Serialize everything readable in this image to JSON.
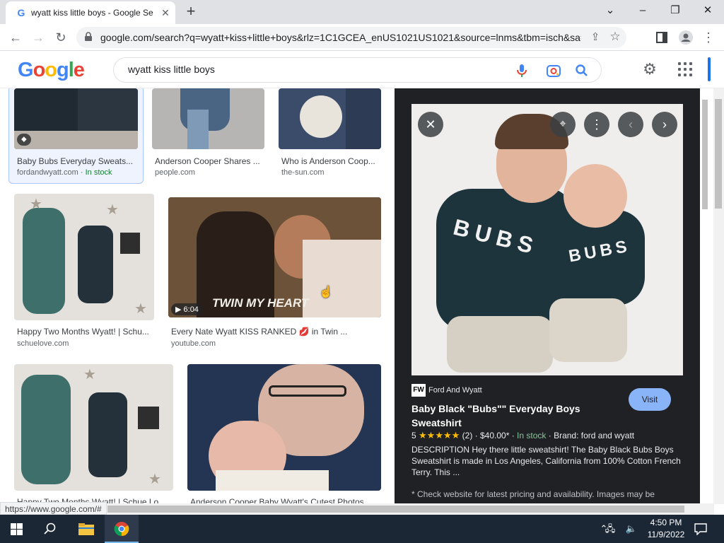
{
  "browser": {
    "tab_title": "wyatt kiss little boys - Google Se",
    "url": "google.com/search?q=wyatt+kiss+little+boys&rlz=1C1GCEA_enUS1021US1021&source=lnms&tbm=isch&sa=X...",
    "status_url": "https://www.google.com/#"
  },
  "google": {
    "query": "wyatt kiss little boys"
  },
  "results": [
    {
      "caption": "Baby Bubs Everyday Sweats...",
      "source": "fordandwyatt.com",
      "stock": "In stock"
    },
    {
      "caption": "Anderson Cooper Shares ...",
      "source": "people.com"
    },
    {
      "caption": "Who is Anderson Coop...",
      "source": "the-sun.com"
    },
    {
      "caption": "Happy Two Months Wyatt! | Schu...",
      "source": "schuelove.com"
    },
    {
      "caption": "Every Nate Wyatt KISS RANKED 💋 in Twin ...",
      "source": "youtube.com",
      "duration": "6:04",
      "overlay": "TWIN MY HEART"
    },
    {
      "caption": "Happy Two Months Wyatt! | Schue Lo...",
      "source": ""
    },
    {
      "caption": "Anderson Cooper Baby Wyatt's Cutest Photos...",
      "source": ""
    }
  ],
  "panel": {
    "site_logo": "FW",
    "site_name": "Ford And Wyatt",
    "title": "Baby Black \"Bubs\"\" Everyday Boys Sweatshirt",
    "visit_label": "Visit",
    "rating": "5",
    "stars": "★★★★★",
    "reviews": "(2)",
    "price": "$40.00*",
    "stock": "In stock",
    "brand": "Brand: ford and wyatt",
    "description": "DESCRIPTION Hey there little sweatshirt! The Baby Black Bubs Boys Sweatshirt is made in Los Angeles, California from 100% Cotton French Terry. This ...",
    "note": "* Check website for latest pricing and availability. Images may be",
    "shirt_text_left": "BUBS",
    "shirt_text_right": "BUBS"
  },
  "taskbar": {
    "time": "4:50 PM",
    "date": "11/9/2022"
  },
  "colors": {
    "google_blue": "#4285f4",
    "google_red": "#ea4335",
    "google_yellow": "#fbbc05",
    "google_green": "#34a853",
    "panel_bg": "#202124",
    "visit_button": "#8ab4f8",
    "taskbar": "#1c2736"
  }
}
